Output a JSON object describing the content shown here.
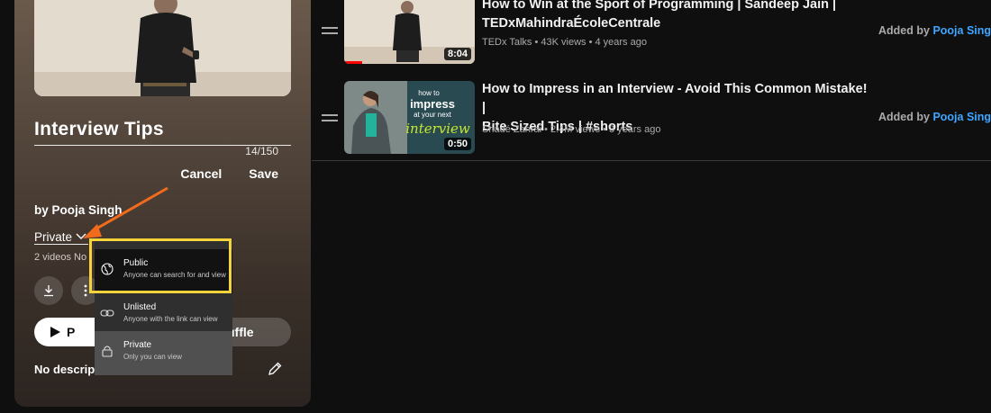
{
  "playlist": {
    "title": "Interview Tips",
    "char_count": "14/150",
    "cancel_label": "Cancel",
    "save_label": "Save",
    "owner": "by Pooja Singh",
    "privacy_value": "Private",
    "meta": "2 videos  No",
    "play_label": "P",
    "shuffle_label": "uffle",
    "description": "No descripti",
    "icons": {
      "chevron": "chevron-down-icon",
      "download": "download-icon",
      "more": "more-vert-icon",
      "play": "play-icon",
      "edit": "pencil-icon"
    }
  },
  "privacy_menu": {
    "options": [
      {
        "label": "Public",
        "sub": "Anyone can search for and view",
        "icon": "globe-icon",
        "selected": true
      },
      {
        "label": "Unlisted",
        "sub": "Anyone with the link can view",
        "icon": "link-icon",
        "selected": false
      },
      {
        "label": "Private",
        "sub": "Only you can view",
        "icon": "lock-icon",
        "selected": false
      }
    ]
  },
  "videos": [
    {
      "title_line1": "How to Win at the Sport of Programming | Sandeep Jain |",
      "title_line2": "TEDxMahindraÉcoleCentrale",
      "channel_meta": "TEDx Talks • 43K views • 4 years ago",
      "duration": "8:04",
      "added_prefix": "Added by",
      "added_by": "Pooja Singh"
    },
    {
      "title_line1": "How to Impress in an Interview - Avoid This Common Mistake! |",
      "title_line2": "Bite Sized Tips | #shorts",
      "channel_meta": "Shadé Zahrai • 2.4M views • 3 years ago",
      "duration": "0:50",
      "thumb_text_1": "how to",
      "thumb_text_2": "impress",
      "thumb_text_3": "at your next",
      "thumb_text_4": "interview",
      "added_prefix": "Added by",
      "added_by": "Pooja Singh"
    }
  ],
  "colors": {
    "highlight_box": "#f5d33a",
    "annotation_arrow": "#f26b1d",
    "link_blue": "#3ea6ff"
  }
}
